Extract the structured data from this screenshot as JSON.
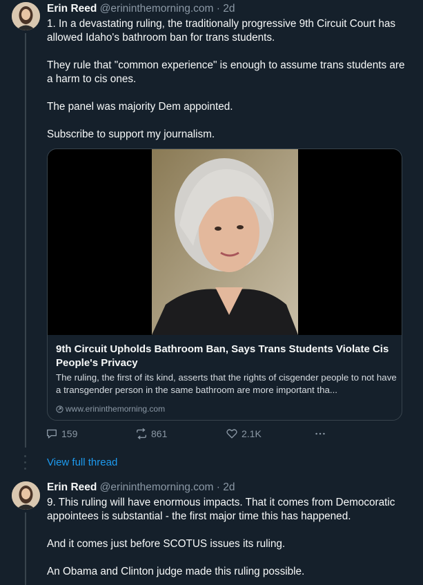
{
  "tweet1": {
    "author_name": "Erin Reed",
    "handle": "@erininthemorning.com",
    "age": "2d",
    "lines": [
      "1. In a devastating ruling, the traditionally progressive 9th Circuit Court has allowed Idaho's bathroom ban for trans students.",
      "They rule that \"common experience\" is enough to assume trans students are a harm to cis ones.",
      "The panel was majority Dem appointed.",
      "Subscribe to support my journalism."
    ],
    "card": {
      "title": "9th Circuit Upholds Bathroom Ban, Says Trans Students Violate Cis People's Privacy",
      "description": "The ruling, the first of its kind, asserts that the rights of cisgender people to not have a transgender person in the same bathroom are more important tha...",
      "domain": "www.erininthemorning.com"
    },
    "actions": {
      "replies": "159",
      "reposts": "861",
      "likes": "2.1K"
    }
  },
  "view_full_thread": "View full thread",
  "tweet2": {
    "author_name": "Erin Reed",
    "handle": "@erininthemorning.com",
    "age": "2d",
    "lines": [
      "9. This ruling will have enormous impacts. That it comes from Democoratic appointees is substantial - the first major time this has happened.",
      "And it comes just before SCOTUS issues its ruling.",
      "An Obama and Clinton judge made this ruling possible."
    ]
  },
  "colors": {
    "background": "#15202b",
    "text": "#f7f9f9",
    "muted": "#8b98a5",
    "link": "#1d9bf0",
    "border": "#38444d"
  }
}
